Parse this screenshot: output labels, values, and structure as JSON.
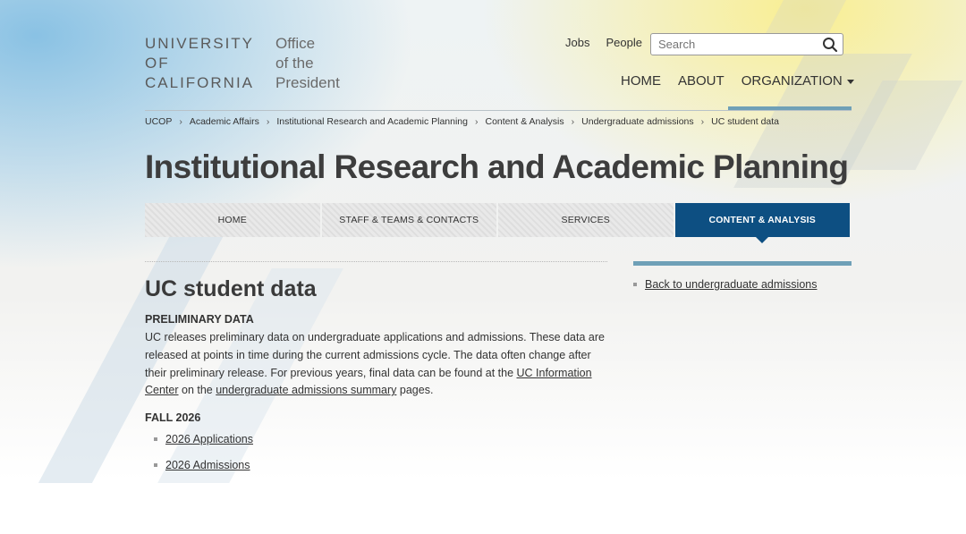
{
  "header": {
    "logo_uc_lines": [
      "UNIVERSITY",
      "OF",
      "CALIFORNIA"
    ],
    "logo_op_lines": [
      "Office",
      "of the",
      "President"
    ],
    "utility_links": [
      "Jobs",
      "People"
    ],
    "search_placeholder": "Search",
    "main_nav": [
      "HOME",
      "ABOUT",
      "ORGANIZATION"
    ]
  },
  "breadcrumb": [
    "UCOP",
    "Academic Affairs",
    "Institutional Research and Academic Planning",
    "Content & Analysis",
    "Undergraduate admissions",
    "UC student data"
  ],
  "site_title": "Institutional Research and Academic Planning",
  "subnav": {
    "tabs": [
      "HOME",
      "STAFF & TEAMS & CONTACTS",
      "SERVICES",
      "CONTENT & ANALYSIS"
    ],
    "active": "CONTENT & ANALYSIS"
  },
  "main": {
    "title": "UC student data",
    "preliminary_heading": "PRELIMINARY DATA",
    "paragraph_part1": "UC releases preliminary data on undergraduate applications and admissions.  These data are released at points in time during the current admissions cycle. The data often change after their preliminary release.  For previous years, final data can be found at the ",
    "paragraph_link1": "UC Information Center",
    "paragraph_part2": " on the ",
    "paragraph_link2": "undergraduate admissions summary",
    "paragraph_part3": " pages.",
    "fall_heading": "FALL 2026",
    "fall_links": [
      "2026 Applications",
      "2026 Admissions"
    ]
  },
  "sidebar": {
    "back_link": "Back to undergraduate admissions"
  },
  "colors": {
    "accent_blue": "#0d4f82",
    "rule_blue": "#6fa0b7"
  }
}
